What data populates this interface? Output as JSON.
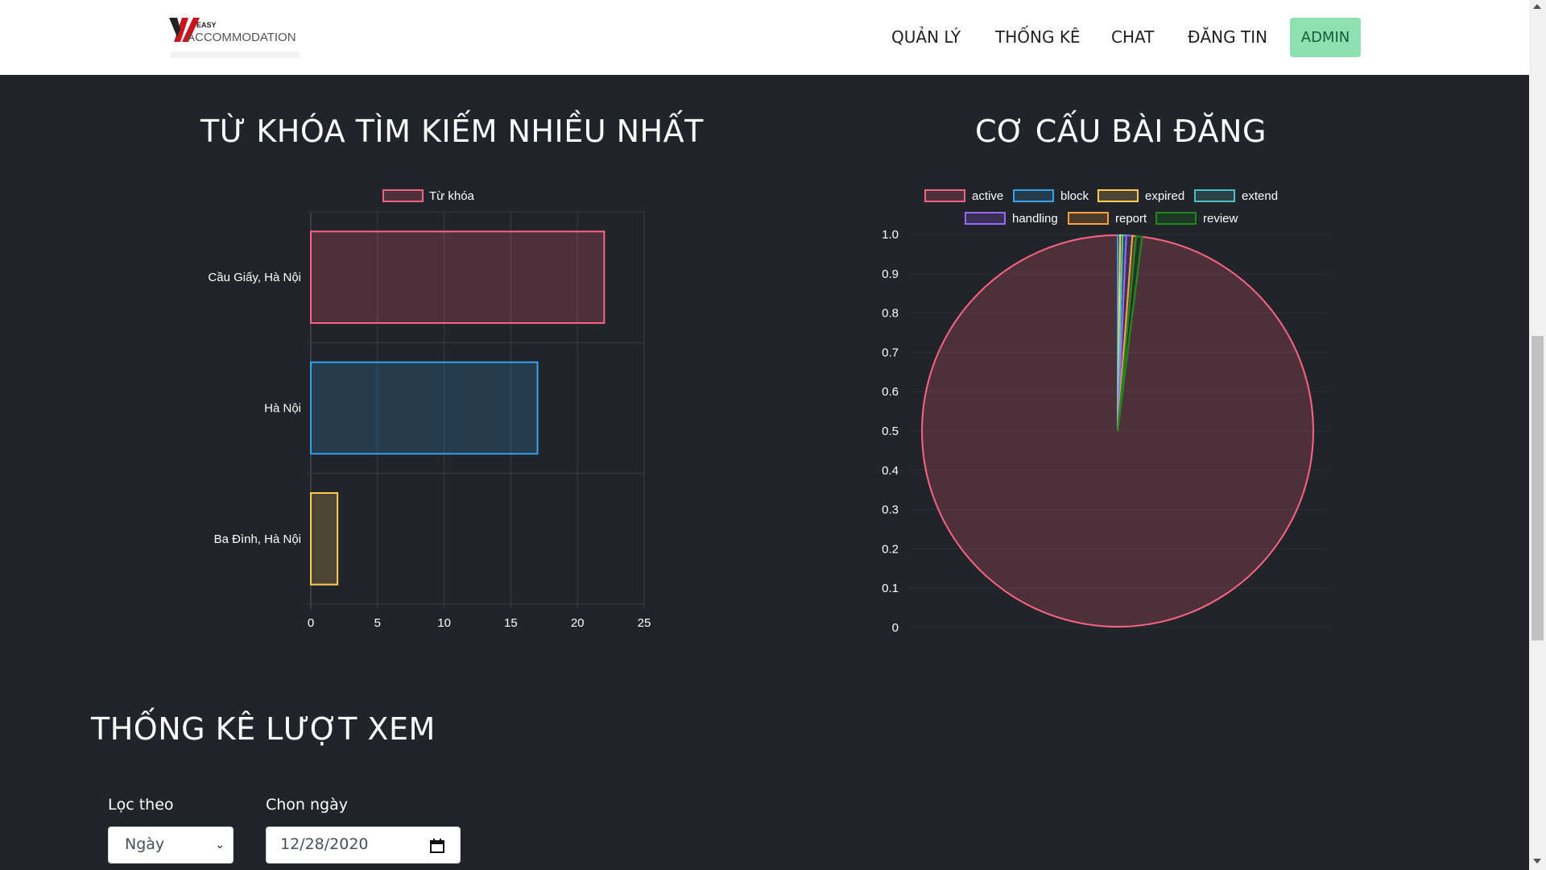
{
  "header": {
    "logo": {
      "brand_top": "EASY",
      "brand_main": "ACCOMMODATION"
    },
    "nav": [
      "QUẢN LÝ",
      "THỐNG KÊ",
      "CHAT",
      "ĐĂNG TIN"
    ],
    "admin_label": "ADMIN"
  },
  "keywords_section": {
    "title": "TỪ KHÓA TÌM KIẾM NHIỀU NHẤT"
  },
  "structure_section": {
    "title": "CƠ CẤU BÀI ĐĂNG"
  },
  "views_section": {
    "title": "THỐNG KÊ LƯỢT XEM"
  },
  "filter": {
    "filter_by_label": "Lọc theo",
    "filter_by_value": "Ngày",
    "date_label": "Chon ngày",
    "date_value": "12/28/2020"
  },
  "chart_data": [
    {
      "type": "bar",
      "orientation": "horizontal",
      "categories": [
        "Cầu Giấy, Hà Nội",
        "Hà Nội",
        "Ba Đình, Hà Nội"
      ],
      "series": [
        {
          "name": "Từ khóa",
          "values": [
            22,
            17,
            2
          ]
        }
      ],
      "bar_colors": [
        "#ff6384",
        "#36a2eb",
        "#ffcd56"
      ],
      "xlim": [
        0,
        25
      ],
      "x_ticks": [
        0,
        5,
        10,
        15,
        20,
        25
      ],
      "legend_position": "top",
      "grid": true
    },
    {
      "type": "pie",
      "labels": [
        "active",
        "block",
        "expired",
        "extend",
        "handling",
        "report",
        "review"
      ],
      "values": [
        980,
        2,
        2,
        3,
        5,
        3,
        5
      ],
      "colors": [
        "#ff6384",
        "#36a2eb",
        "#ffcd56",
        "#4bc0c0",
        "#9966ff",
        "#ff9f40",
        "#1a8a1a"
      ],
      "y_ticks": [
        "0",
        "0.1",
        "0.2",
        "0.3",
        "0.4",
        "0.5",
        "0.6",
        "0.7",
        "0.8",
        "0.9",
        "1.0"
      ],
      "legend_position": "top"
    }
  ]
}
